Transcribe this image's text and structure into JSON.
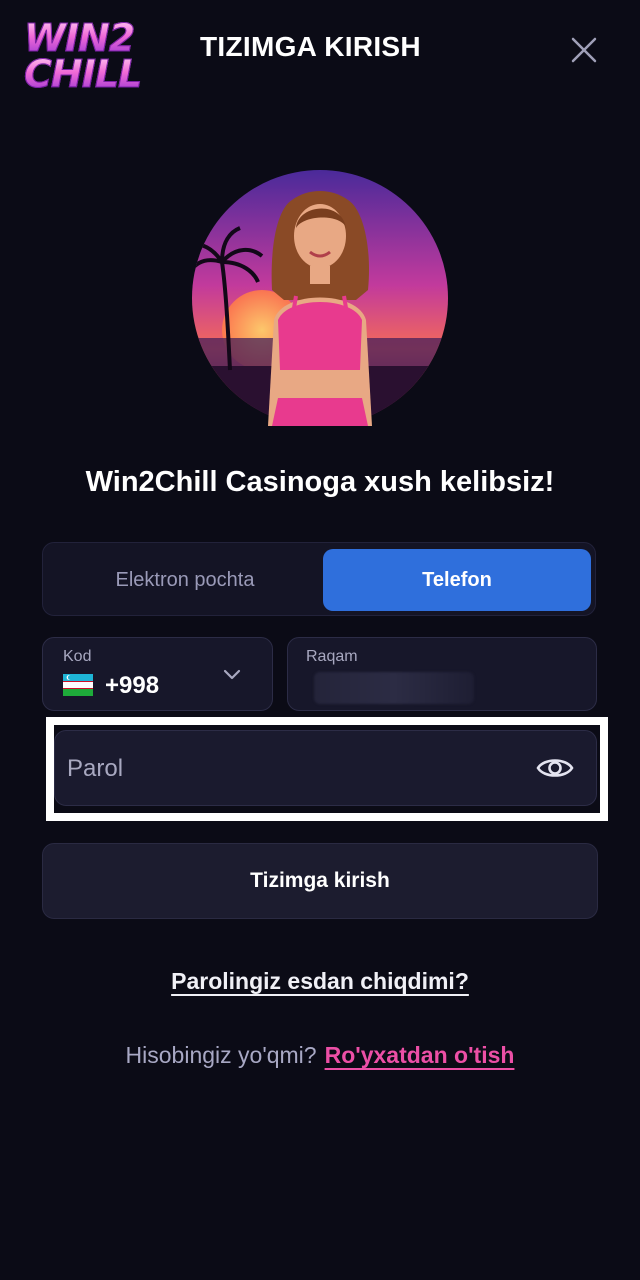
{
  "header": {
    "logo_line1": "WIN2",
    "logo_line2": "CHILL",
    "title": "TIZIMGA KIRISH",
    "close_icon": "close-icon"
  },
  "hero": {
    "avatar_icon": "casino-host-avatar",
    "welcome": "Win2Chill Casinoga xush kelibsiz!"
  },
  "tabs": [
    {
      "label": "Elektron pochta",
      "active": false
    },
    {
      "label": "Telefon",
      "active": true
    }
  ],
  "phone": {
    "code_label": "Kod",
    "code_value": "+998",
    "country_flag": "uzbekistan-flag",
    "number_label": "Raqam",
    "number_value": ""
  },
  "password": {
    "placeholder": "Parol",
    "visibility_icon": "eye-icon"
  },
  "actions": {
    "login_label": "Tizimga kirish",
    "forgot_label": "Parolingiz esdan chiqdimi?",
    "signup_prompt": "Hisobingiz yo'qmi?",
    "signup_label": "Ro'yxatdan o'tish"
  },
  "colors": {
    "background": "#0b0b16",
    "accent_blue": "#2f6fdc",
    "signup_pink": "#ec4fa6"
  }
}
